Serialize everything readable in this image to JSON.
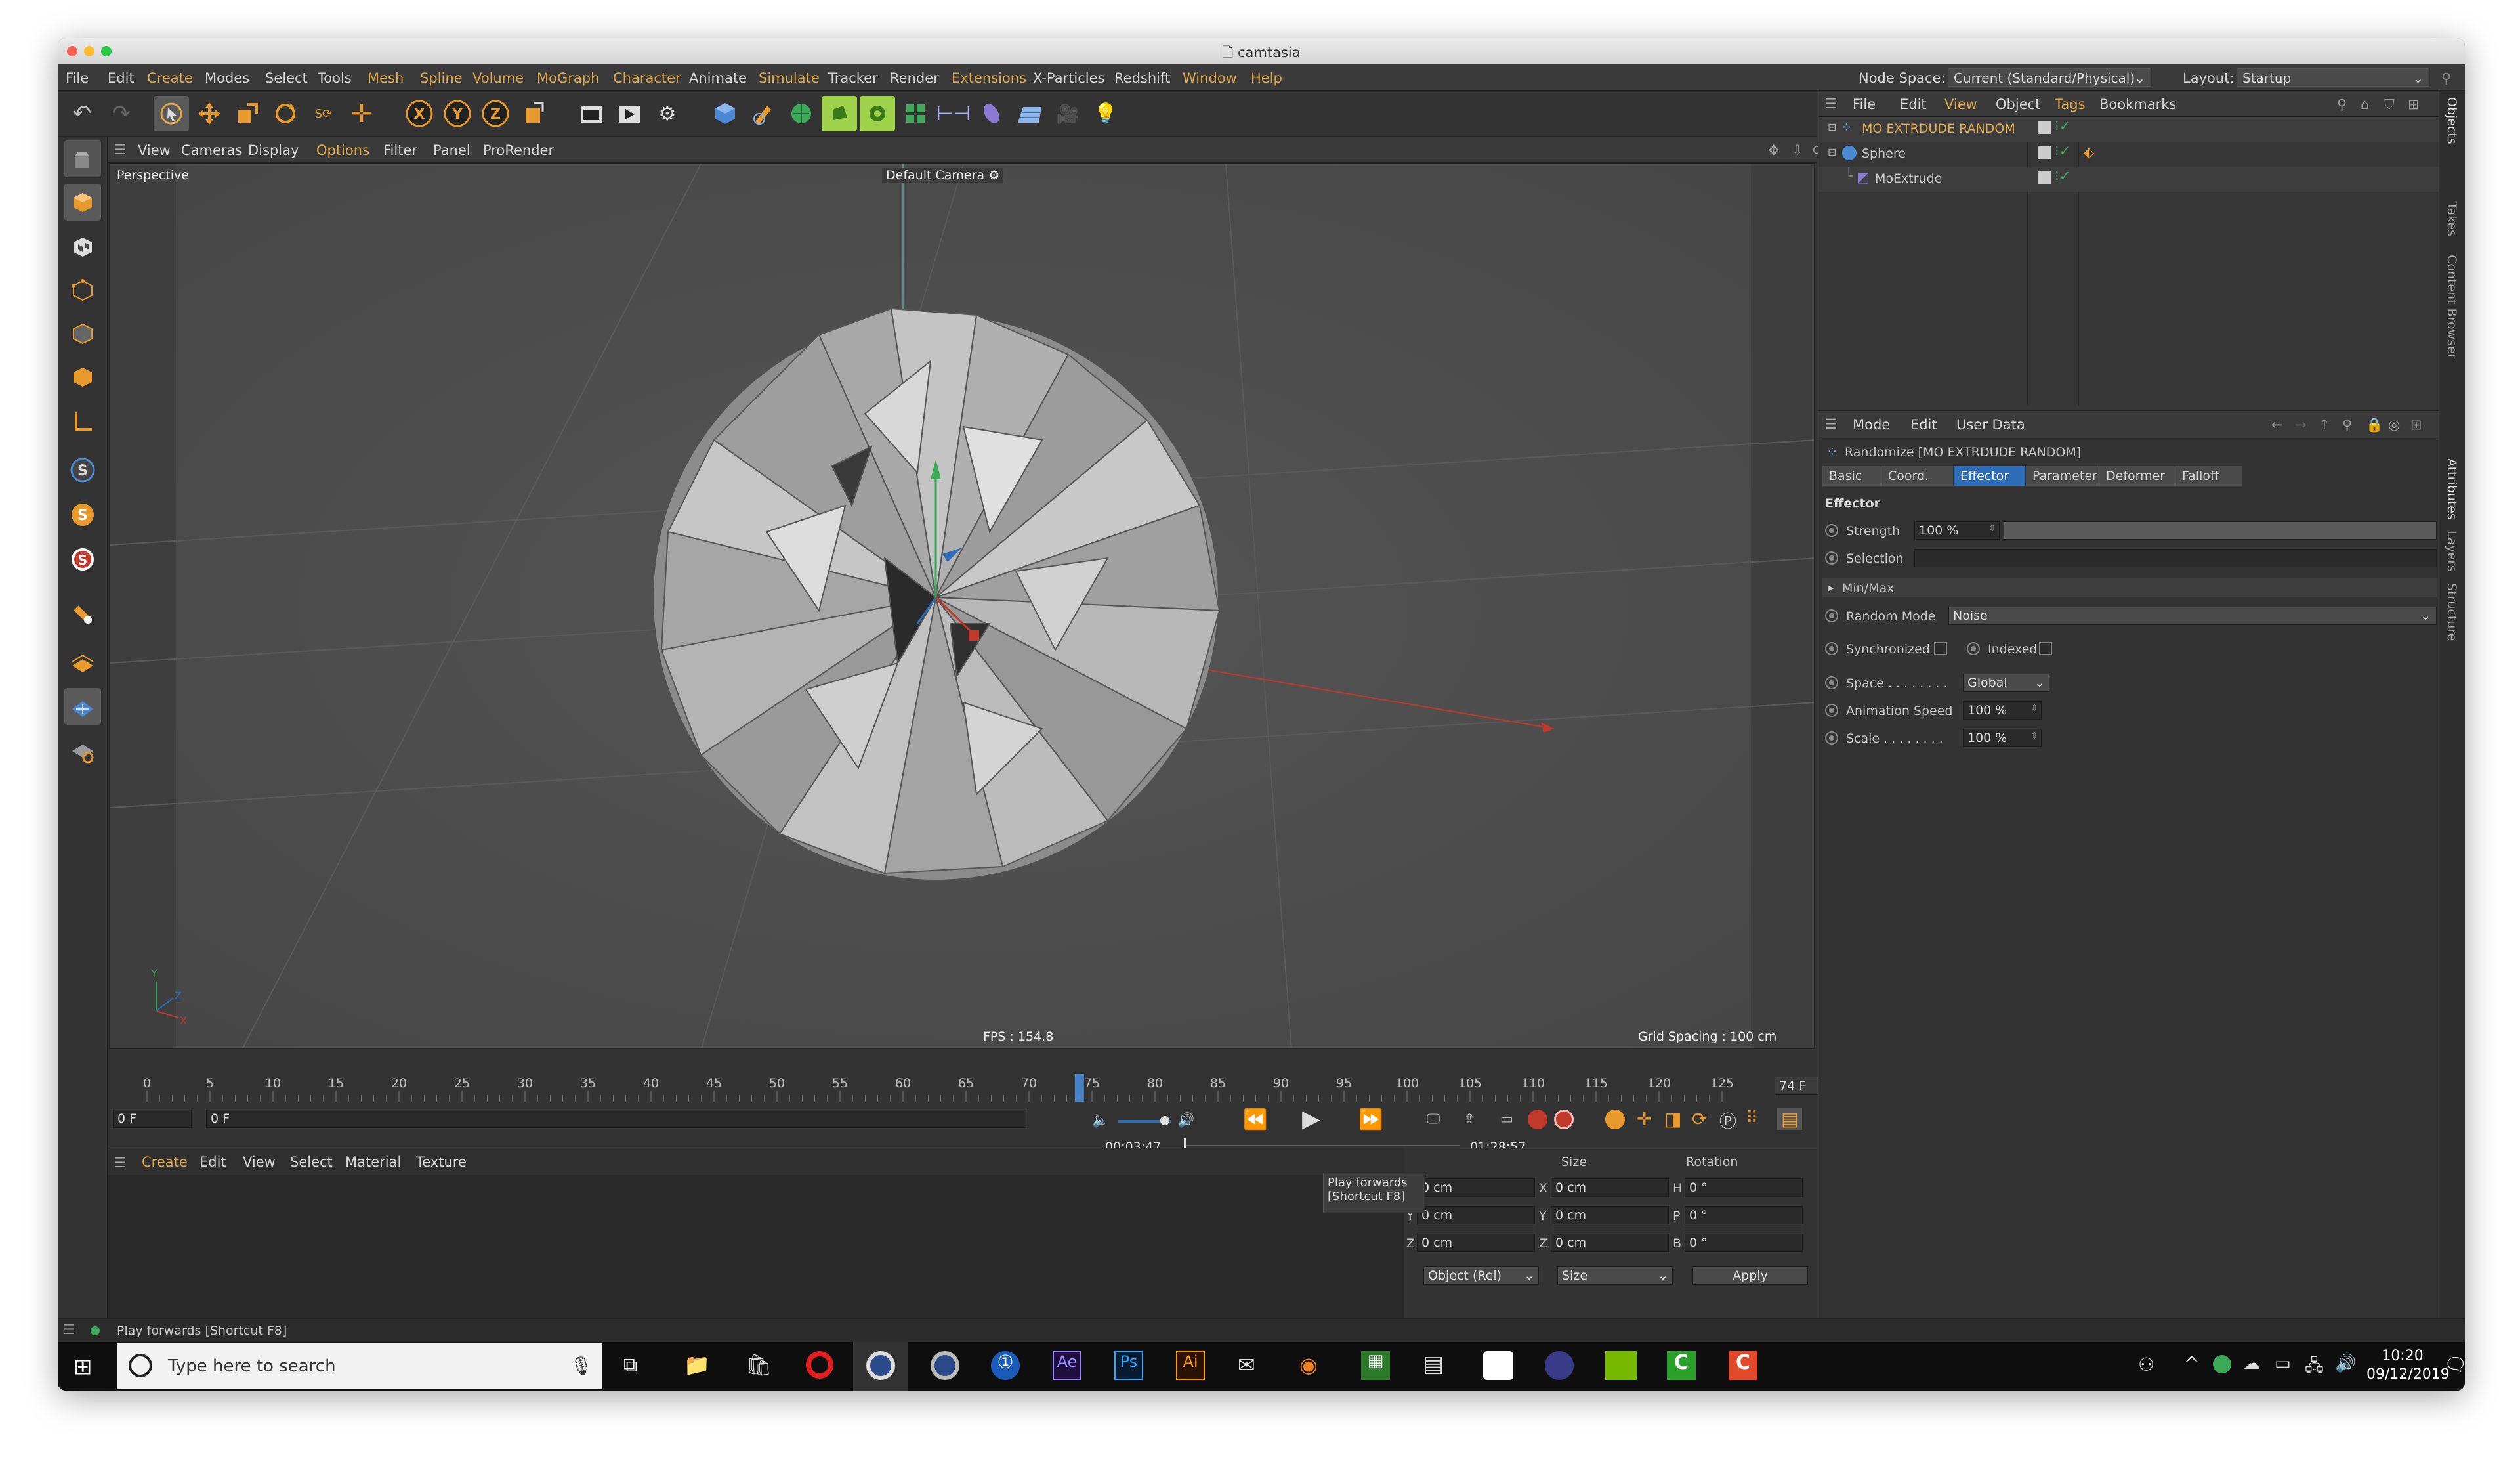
{
  "window": {
    "title": "camtasia"
  },
  "menu": {
    "items": [
      "File",
      "Edit",
      "Create",
      "Modes",
      "Select",
      "Tools",
      "Mesh",
      "Spline",
      "Volume",
      "MoGraph",
      "Character",
      "Animate",
      "Simulate",
      "Tracker",
      "Render",
      "Extensions",
      "X-Particles",
      "Redshift",
      "Window",
      "Help"
    ],
    "node_space_label": "Node Space:",
    "node_space_value": "Current (Standard/Physical)",
    "layout_label": "Layout:",
    "layout_value": "Startup"
  },
  "viewport": {
    "menu": [
      "View",
      "Cameras",
      "Display",
      "Options",
      "Filter",
      "Panel",
      "ProRender"
    ],
    "view_name": "Perspective",
    "camera_name": "Default Camera",
    "fps": "FPS : 154.8",
    "grid_spacing": "Grid Spacing : 100 cm"
  },
  "timeline": {
    "ticks": [
      "0",
      "5",
      "10",
      "15",
      "20",
      "25",
      "30",
      "35",
      "40",
      "45",
      "50",
      "55",
      "60",
      "65",
      "70",
      "75",
      "80",
      "85",
      "90",
      "95",
      "100",
      "105",
      "110",
      "115",
      "120",
      "125"
    ],
    "current_frame_field": "74 F",
    "start_field": "0 F",
    "range_start": "0 F",
    "time_current": "00:03:47",
    "time_total": "01:28:57",
    "playhead_frame": 74,
    "max_frame": 125
  },
  "tooltip": {
    "line1": "Play forwards",
    "line2": "[Shortcut F8]"
  },
  "material_menu": [
    "Create",
    "Edit",
    "View",
    "Select",
    "Material",
    "Texture"
  ],
  "coords": {
    "col_size": "Size",
    "col_rotation": "Rotation",
    "rows": [
      {
        "axis": "X",
        "pos": "0 cm",
        "size_axis": "X",
        "size": "0 cm",
        "rot_axis": "H",
        "rot": "0 °"
      },
      {
        "axis": "Y",
        "pos": "0 cm",
        "size_axis": "Y",
        "size": "0 cm",
        "rot_axis": "P",
        "rot": "0 °"
      },
      {
        "axis": "Z",
        "pos": "0 cm",
        "size_axis": "Z",
        "size": "0 cm",
        "rot_axis": "B",
        "rot": "0 °"
      }
    ],
    "mode_select": "Object (Rel)",
    "size_select": "Size",
    "apply": "Apply"
  },
  "objects": {
    "menu": [
      "File",
      "Edit",
      "View",
      "Object",
      "Tags",
      "Bookmarks"
    ],
    "items": [
      {
        "name": "MO EXTRDUDE RANDOM",
        "color": "#e0a84c",
        "indent": 0
      },
      {
        "name": "Sphere",
        "color": "#d0d0d0",
        "indent": 0
      },
      {
        "name": "MoExtrude",
        "color": "#d0d0d0",
        "indent": 1
      }
    ]
  },
  "attributes": {
    "menu": [
      "Mode",
      "Edit",
      "User Data"
    ],
    "object_title": "Randomize [MO EXTRDUDE RANDOM]",
    "tabs": [
      "Basic",
      "Coord.",
      "Effector",
      "Parameter",
      "Deformer",
      "Falloff"
    ],
    "active_tab": "Effector",
    "section": "Effector",
    "strength_label": "Strength",
    "strength_value": "100 %",
    "strength_fraction": 1.0,
    "selection_label": "Selection",
    "minmax_label": "Min/Max",
    "random_mode_label": "Random Mode",
    "random_mode_value": "Noise",
    "synchronized_label": "Synchronized",
    "indexed_label": "Indexed",
    "space_label": "Space . . . . . . . .",
    "space_value": "Global",
    "anim_speed_label": "Animation Speed",
    "anim_speed_value": "100 %",
    "scale_label": "Scale . . . . . . . .",
    "scale_value": "100 %"
  },
  "right_tabs": [
    "Objects",
    "Takes",
    "Content Browser",
    "Attributes",
    "Layers",
    "Structure"
  ],
  "status": {
    "text": "Play forwards [Shortcut F8]"
  },
  "taskbar": {
    "search_placeholder": "Type here to search",
    "time": "10:20",
    "date": "09/12/2019"
  }
}
